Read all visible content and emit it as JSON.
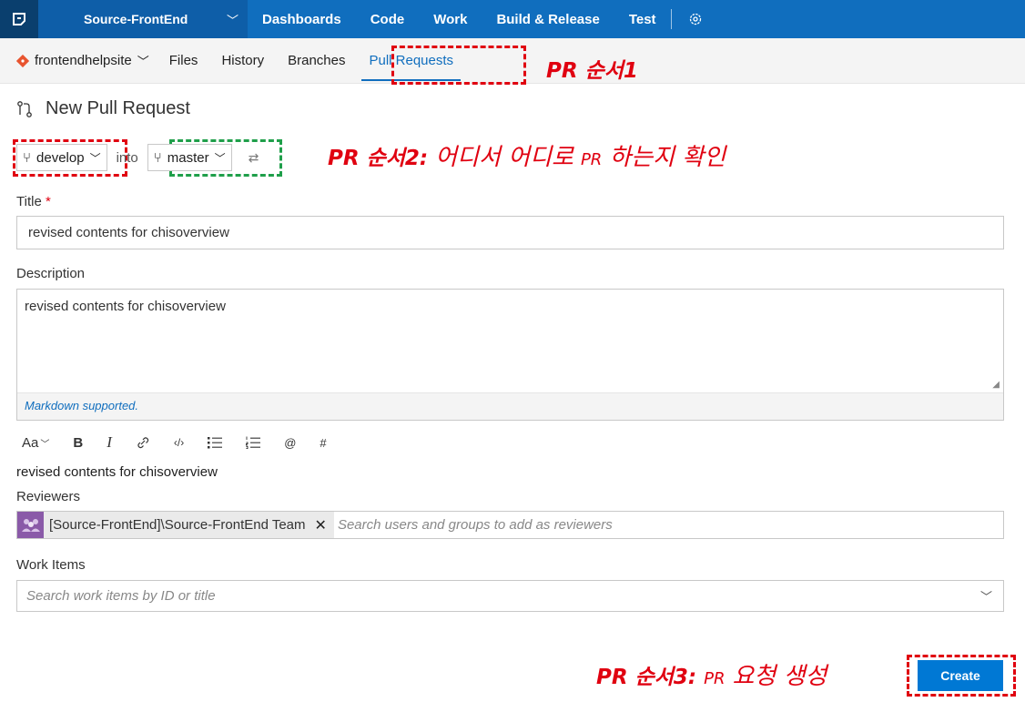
{
  "topbar": {
    "project": "Source-FrontEnd",
    "nav": [
      "Dashboards",
      "Code",
      "Work",
      "Build & Release",
      "Test"
    ]
  },
  "subnav": {
    "repo": "frontendhelpsite",
    "items": [
      "Files",
      "History",
      "Branches",
      "Pull Requests"
    ]
  },
  "annotations": {
    "step1": "PR 순서1",
    "step2_bold": "PR 순서2:",
    "step2_text": "어디서 어디로",
    "step2_pr": "PR",
    "step2_tail": "하는지 확인",
    "step3_bold": "PR 순서3:",
    "step3_pr": "PR",
    "step3_tail": "요청 생성"
  },
  "page": {
    "title": "New Pull Request"
  },
  "branches": {
    "source": "develop",
    "into": "into",
    "target": "master"
  },
  "form": {
    "title_label": "Title",
    "title_required": "*",
    "title_value": "revised contents for chisoverview",
    "description_label": "Description",
    "description_value": "revised contents for chisoverview",
    "markdown_note": "Markdown supported.",
    "preview_text": "revised contents for chisoverview",
    "reviewers_label": "Reviewers",
    "reviewer_team": "[Source-FrontEnd]\\Source-FrontEnd Team",
    "reviewers_placeholder": "Search users and groups to add as reviewers",
    "work_items_label": "Work Items",
    "work_items_placeholder": "Search work items by ID or title",
    "create_label": "Create"
  },
  "toolbar": {
    "font": "Aa",
    "bold": "B",
    "italic": "I",
    "mention": "@",
    "hash": "#"
  },
  "colors": {
    "topbar": "#106ebe",
    "accent": "#0078d4",
    "annotation_red": "#e00010",
    "annotation_green": "#1f9f4a"
  }
}
